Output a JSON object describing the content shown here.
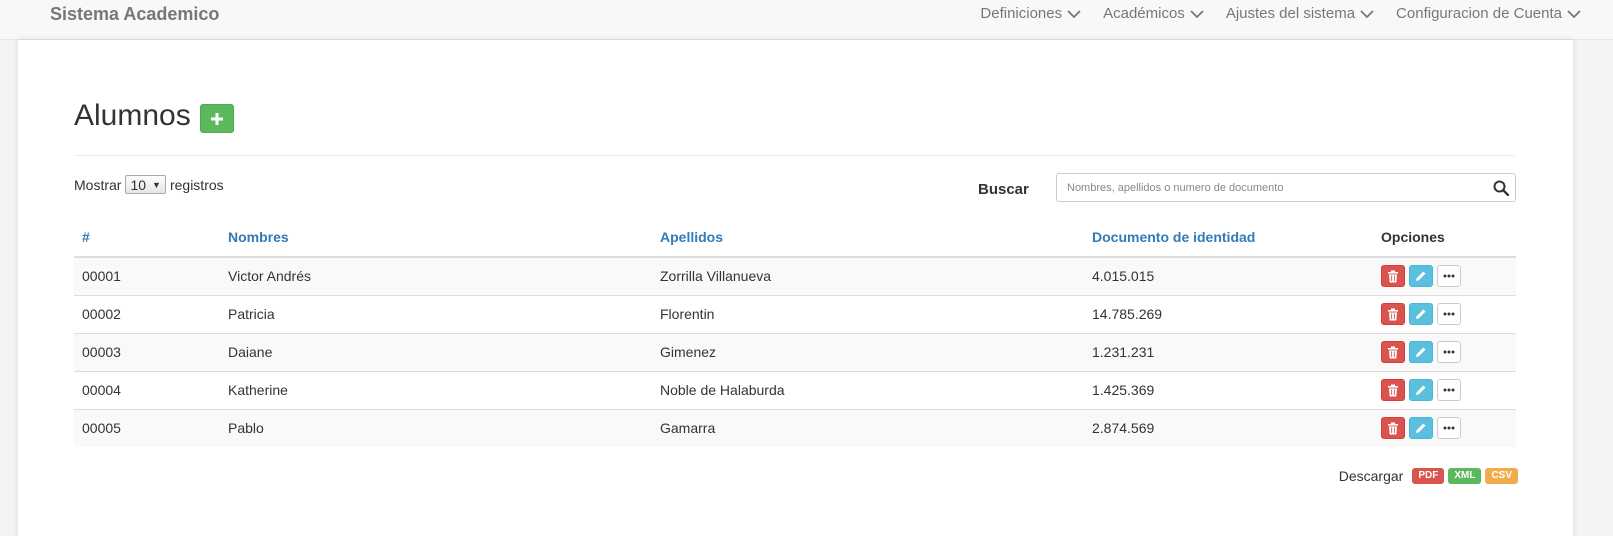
{
  "navbar": {
    "brand": "Sistema Academico",
    "menus": [
      {
        "label": "Definiciones"
      },
      {
        "label": "Académicos"
      },
      {
        "label": "Ajustes del sistema"
      },
      {
        "label": "Configuracion de Cuenta"
      }
    ]
  },
  "page": {
    "title": "Alumnos",
    "add_icon": "plus-icon"
  },
  "length_control": {
    "prefix": "Mostrar",
    "selected": "10",
    "suffix": "registros"
  },
  "search": {
    "label": "Buscar",
    "placeholder": "Nombres, apellidos o numero de documento",
    "value": "",
    "icon": "search-icon"
  },
  "table": {
    "headers": [
      "#",
      "Nombres",
      "Apellidos",
      "Documento de identidad",
      "Opciones"
    ],
    "rows": [
      {
        "id": "00001",
        "nombres": "Victor Andrés",
        "apellidos": "Zorrilla Villanueva",
        "documento": "4.015.015"
      },
      {
        "id": "00002",
        "nombres": "Patricia",
        "apellidos": "Florentin",
        "documento": "14.785.269"
      },
      {
        "id": "00003",
        "nombres": "Daiane",
        "apellidos": "Gimenez",
        "documento": "1.231.231"
      },
      {
        "id": "00004",
        "nombres": "Katherine",
        "apellidos": "Noble de Halaburda",
        "documento": "1.425.369"
      },
      {
        "id": "00005",
        "nombres": "Pablo",
        "apellidos": "Gamarra",
        "documento": "2.874.569"
      }
    ],
    "row_actions": [
      "trash-icon",
      "pencil-icon",
      "ellipsis-icon"
    ]
  },
  "downloads": {
    "label": "Descargar",
    "formats": [
      {
        "label": "PDF",
        "color": "#d9534f"
      },
      {
        "label": "XML",
        "color": "#5cb85c"
      },
      {
        "label": "CSV",
        "color": "#f0ad4e"
      }
    ]
  },
  "colors": {
    "link": "#337ab7",
    "success": "#5cb85c",
    "danger": "#d9534f",
    "info": "#5bc0de",
    "warning": "#f0ad4e"
  }
}
